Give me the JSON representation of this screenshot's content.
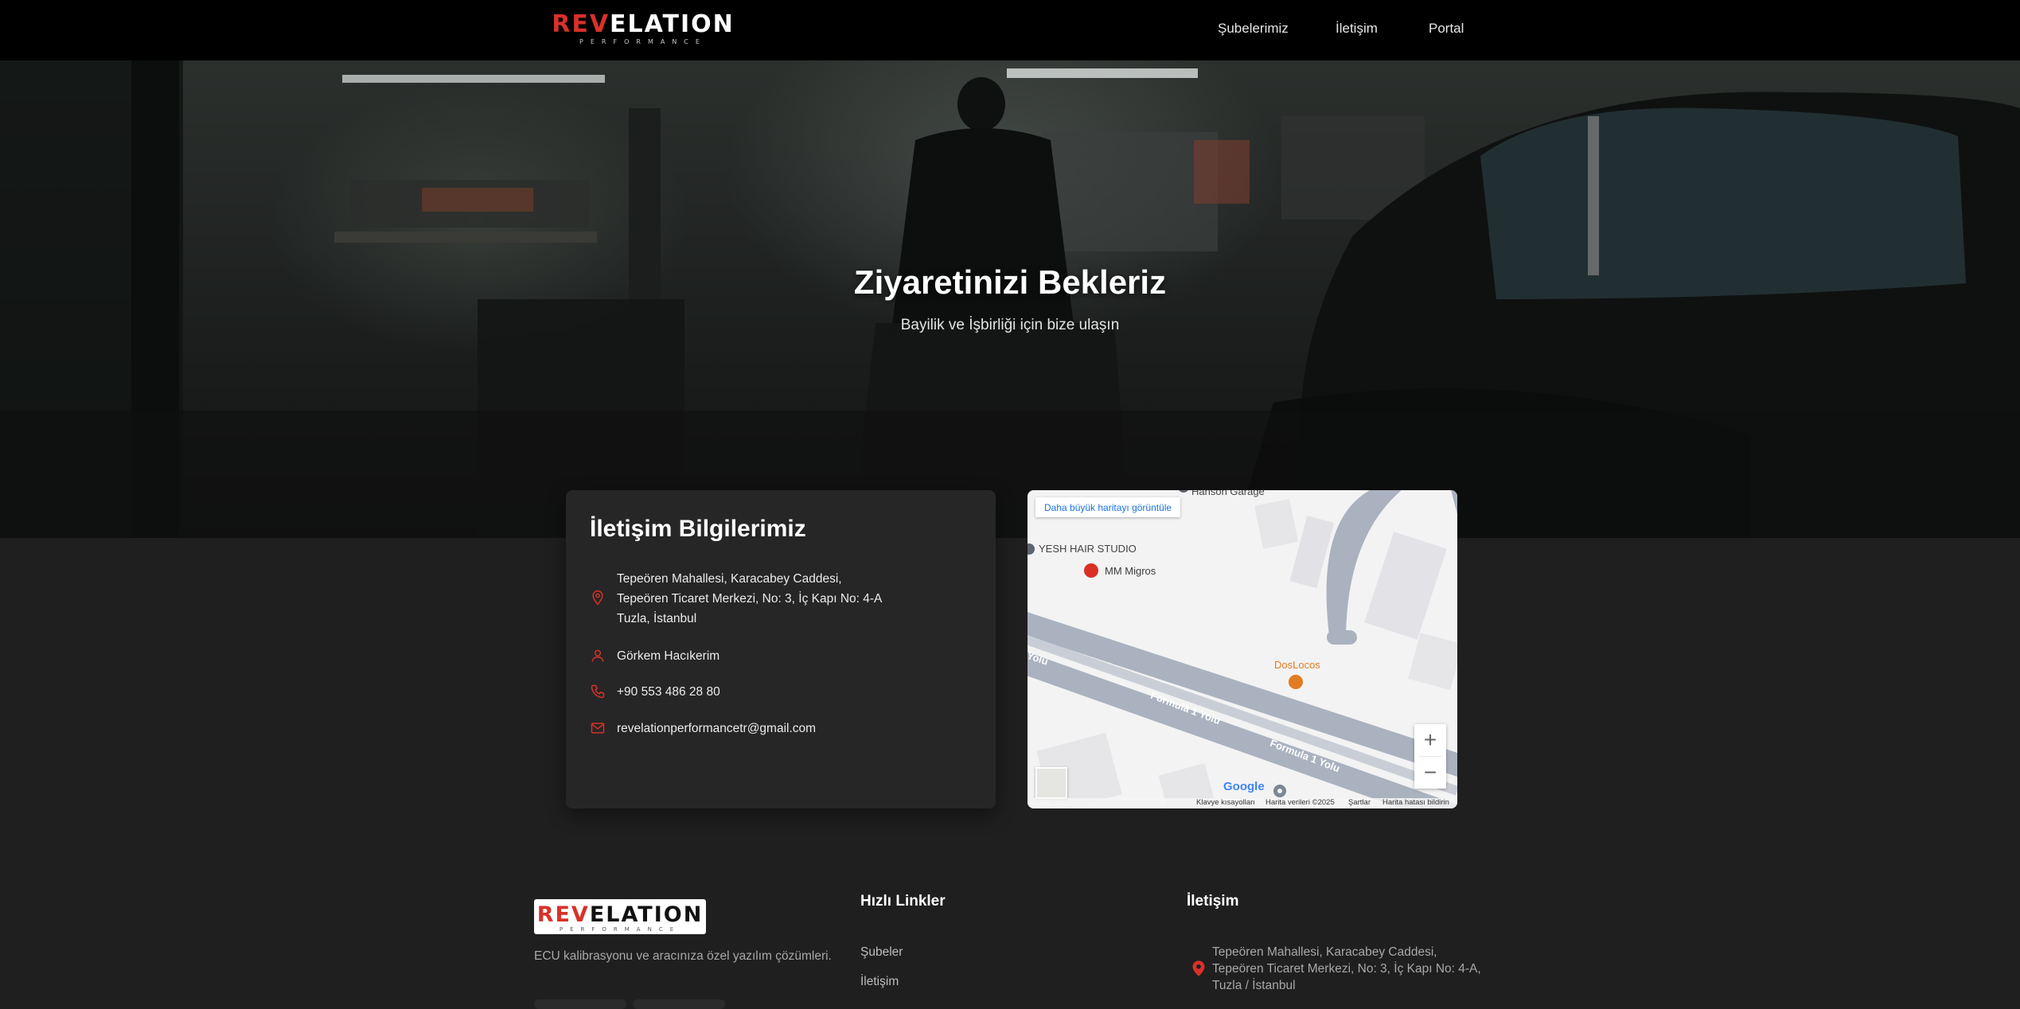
{
  "nav": {
    "logo_rev": "REV",
    "logo_elation": "ELATION",
    "logo_sub": "PERFORMANCE",
    "links": [
      {
        "label": "Şubelerimiz"
      },
      {
        "label": "İletişim"
      },
      {
        "label": "Portal"
      }
    ]
  },
  "hero": {
    "title": "Ziyaretinizi Bekleriz",
    "subtitle": "Bayilik ve İşbirliği için bize ulaşın"
  },
  "contact_card": {
    "title": "İletişim Bilgilerimiz",
    "address_line1": "Tepeören Mahallesi, Karacabey Caddesi,",
    "address_line2": "Tepeören Ticaret Merkezi, No: 3, İç Kapı No: 4-A",
    "address_line3": "Tuzla, İstanbul",
    "person": "Görkem Hacıkerim",
    "phone": "+90 553 486 28 80",
    "email": "revelationperformancetr@gmail.com"
  },
  "map": {
    "view_larger_label": "Daha büyük haritayı görüntüle",
    "labels": {
      "top_cut": "Hanson Garage",
      "yesh": "YESH HAIR STUDIO",
      "migros": "MM Migros",
      "doslocos": "DosLocos",
      "road_left": "Yolu",
      "road1": "Formula 1 Yolu",
      "road2": "Formula 1 Yolu"
    },
    "zoom_in": "+",
    "zoom_out": "−",
    "google": "Google",
    "attribution": {
      "shortcuts": "Klavye kısayolları",
      "data": "Harita verileri ©2025",
      "terms": "Şartlar",
      "report": "Harita hatası bildirin"
    }
  },
  "footer": {
    "logo_rev": "REV",
    "logo_elation": "ELATION",
    "logo_sub": "PERFORMANCE",
    "tagline": "ECU kalibrasyonu ve aracınıza özel yazılım çözümleri.",
    "quick_links_title": "Hızlı Linkler",
    "quick_links": [
      {
        "label": "Şubeler"
      },
      {
        "label": "İletişim"
      }
    ],
    "contact_title": "İletişim",
    "address_line1": "Tepeören Mahallesi, Karacabey Caddesi,",
    "address_line2": "Tepeören Ticaret Merkezi, No: 3, İç Kapı No: 4-A,",
    "address_line3": "Tuzla / İstanbul"
  },
  "colors": {
    "accent": "#d8312a",
    "navbar_bg": "#000000",
    "page_bg": "#1f1f1f",
    "card_bg": "#262626",
    "map_orange": "#e37b23",
    "map_red": "#d93025"
  },
  "icons": {
    "address": "map-pin-icon",
    "person": "user-icon",
    "phone": "phone-icon",
    "email": "mail-icon"
  }
}
